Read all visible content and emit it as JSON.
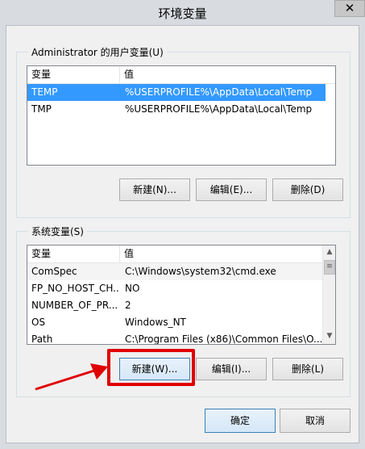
{
  "window": {
    "title": "环境变量",
    "close_label": "✕"
  },
  "user_group": {
    "label": "Administrator 的用户变量(U)",
    "columns": [
      "变量",
      "值"
    ],
    "rows": [
      {
        "name": "TEMP",
        "value": "%USERPROFILE%\\AppData\\Local\\Temp",
        "selected": true
      },
      {
        "name": "TMP",
        "value": "%USERPROFILE%\\AppData\\Local\\Temp",
        "selected": false
      }
    ],
    "buttons": {
      "new": "新建(N)...",
      "edit": "编辑(E)...",
      "delete": "删除(D)"
    }
  },
  "system_group": {
    "label": "系统变量(S)",
    "columns": [
      "变量",
      "值"
    ],
    "rows": [
      {
        "name": "ComSpec",
        "value": "C:\\Windows\\system32\\cmd.exe"
      },
      {
        "name": "FP_NO_HOST_CH...",
        "value": "NO"
      },
      {
        "name": "NUMBER_OF_PR...",
        "value": "2"
      },
      {
        "name": "OS",
        "value": "Windows_NT"
      },
      {
        "name": "Path",
        "value": "C:\\Program Files (x86)\\Common Files\\O..."
      }
    ],
    "buttons": {
      "new": "新建(W)...",
      "edit": "编辑(I)...",
      "delete": "删除(L)"
    }
  },
  "footer": {
    "ok": "确定",
    "cancel": "取消"
  },
  "colors": {
    "selection": "#3399ff",
    "highlight": "#e00000"
  }
}
